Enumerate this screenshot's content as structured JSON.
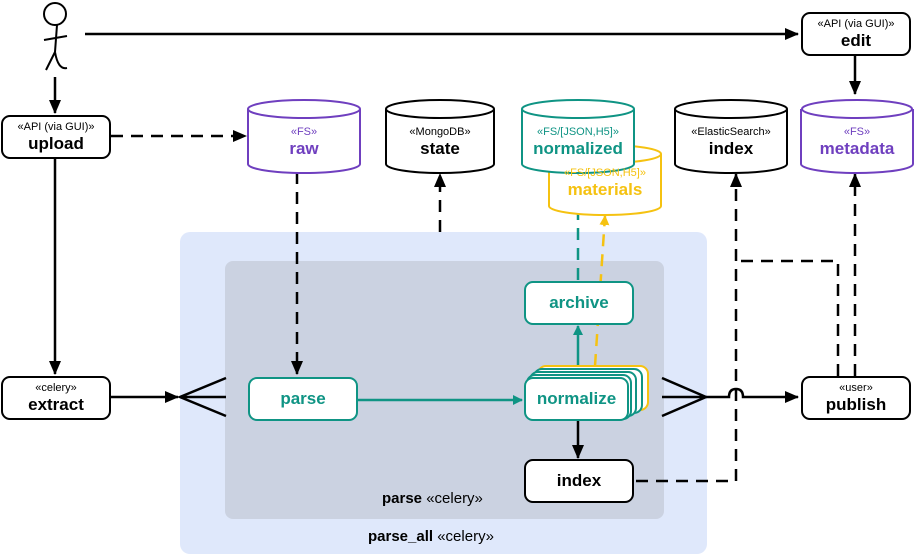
{
  "colors": {
    "black": "#000000",
    "teal": "#0f9484",
    "purple": "#6f3fbf",
    "yellow": "#f5c211",
    "outer_group_bg": "#dfe8fb",
    "inner_group_bg": "#cbd2e1"
  },
  "actor": {
    "icon": "stick-figure-icon"
  },
  "groups": {
    "parse_all": {
      "name": "parse_all",
      "stereotype": "«celery»"
    },
    "parse": {
      "name": "parse",
      "stereotype": "«celery»"
    }
  },
  "nodes": {
    "upload": {
      "stereotype": "«API (via GUI)»",
      "title": "upload"
    },
    "edit": {
      "stereotype": "«API (via GUI)»",
      "title": "edit"
    },
    "extract": {
      "stereotype": "«celery»",
      "title": "extract"
    },
    "publish": {
      "stereotype": "«user»",
      "title": "publish"
    },
    "parse": {
      "title": "parse"
    },
    "normalize": {
      "title": "normalize"
    },
    "archive": {
      "title": "archive"
    },
    "index_task": {
      "title": "index"
    }
  },
  "stores": {
    "raw": {
      "stereotype": "«FS»",
      "title": "raw"
    },
    "state": {
      "stereotype": "«MongoDB»",
      "title": "state"
    },
    "normalized": {
      "stereotype": "«FS/[JSON,H5]»",
      "title": "normalized"
    },
    "materials": {
      "stereotype": "«FS/[JSON,H5]»",
      "title": "materials"
    },
    "index": {
      "stereotype": "«ElasticSearch»",
      "title": "index"
    },
    "metadata": {
      "stereotype": "«FS»",
      "title": "metadata"
    }
  }
}
